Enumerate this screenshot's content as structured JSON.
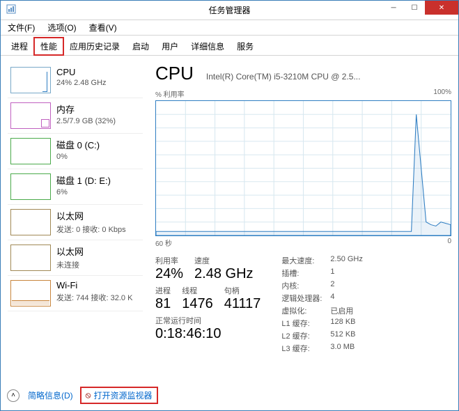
{
  "window": {
    "title": "任务管理器"
  },
  "menu": {
    "file": "文件(F)",
    "options": "选项(O)",
    "view": "查看(V)"
  },
  "tabs": {
    "items": [
      "进程",
      "性能",
      "应用历史记录",
      "启动",
      "用户",
      "详细信息",
      "服务"
    ],
    "active": 1
  },
  "sidebar": [
    {
      "name": "CPU",
      "sub": "24% 2.48 GHz",
      "thumb": "cpu"
    },
    {
      "name": "内存",
      "sub": "2.5/7.9 GB (32%)",
      "thumb": "mem"
    },
    {
      "name": "磁盘 0 (C:)",
      "sub": "0%",
      "thumb": "disk"
    },
    {
      "name": "磁盘 1 (D: E:)",
      "sub": "6%",
      "thumb": "disk"
    },
    {
      "name": "以太网",
      "sub": "发送: 0 接收: 0 Kbps",
      "thumb": "eth"
    },
    {
      "name": "以太网",
      "sub": "未连接",
      "thumb": "eth"
    },
    {
      "name": "Wi-Fi",
      "sub": "发送: 744 接收: 32.0 K",
      "thumb": "wifi"
    }
  ],
  "cpu": {
    "title": "CPU",
    "model": "Intel(R) Core(TM) i5-3210M CPU @ 2.5...",
    "chart": {
      "ylabel": "% 利用率",
      "ymax": "100%",
      "xleft": "60 秒",
      "xright": "0"
    },
    "util_lbl": "利用率",
    "util": "24%",
    "speed_lbl": "速度",
    "speed": "2.48 GHz",
    "proc_lbl": "进程",
    "proc": "81",
    "thr_lbl": "线程",
    "thr": "1476",
    "hnd_lbl": "句柄",
    "hnd": "41117",
    "uptime_lbl": "正常运行时间",
    "uptime": "0:18:46:10",
    "spec": {
      "maxspeed_lbl": "最大速度:",
      "maxspeed": "2.50 GHz",
      "sockets_lbl": "插槽:",
      "sockets": "1",
      "cores_lbl": "内核:",
      "cores": "2",
      "lproc_lbl": "逻辑处理器:",
      "lproc": "4",
      "virt_lbl": "虚拟化:",
      "virt": "已启用",
      "l1_lbl": "L1 缓存:",
      "l1": "128 KB",
      "l2_lbl": "L2 缓存:",
      "l2": "512 KB",
      "l3_lbl": "L3 缓存:",
      "l3": "3.0 MB"
    }
  },
  "footer": {
    "fewer": "简略信息(D)",
    "resmon": "打开资源监视器"
  },
  "chart_data": {
    "type": "line",
    "title": "% 利用率",
    "xlabel": "60 秒 → 0",
    "ylabel": "% 利用率",
    "ylim": [
      0,
      100
    ],
    "x": [
      0,
      5,
      10,
      15,
      20,
      25,
      30,
      35,
      40,
      45,
      50,
      52,
      53,
      54,
      55,
      56,
      57,
      58,
      59,
      60
    ],
    "values": [
      3,
      3,
      3,
      3,
      3,
      3,
      3,
      3,
      3,
      3,
      3,
      3,
      90,
      50,
      10,
      8,
      7,
      10,
      9,
      8
    ]
  }
}
